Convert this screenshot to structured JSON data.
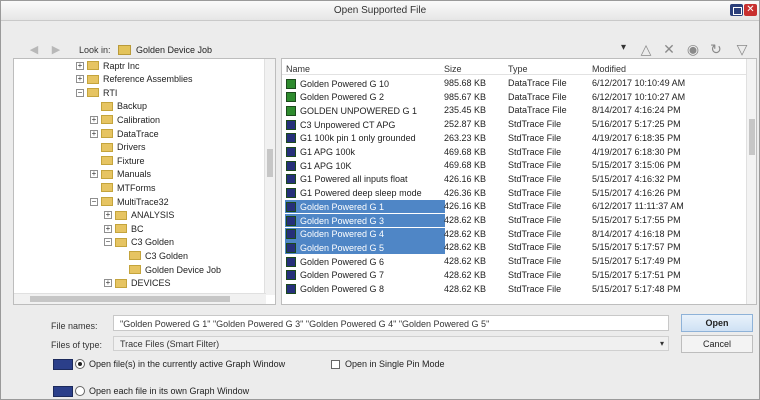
{
  "window": {
    "title": "Open Supported File"
  },
  "lookin": {
    "label": "Look in:",
    "value": "Golden Device Job"
  },
  "icons": {
    "back": "arrow-left-icon",
    "forward": "arrow-right-icon",
    "up": "triangle-up-icon",
    "delete": "x-icon",
    "view": "circle-view-icon",
    "refresh": "refresh-icon",
    "filter": "funnel-icon"
  },
  "tree": [
    {
      "label": "Raptr Inc",
      "level": 1,
      "exp": "+"
    },
    {
      "label": "Reference Assemblies",
      "level": 1,
      "exp": "+"
    },
    {
      "label": "RTI",
      "level": 1,
      "exp": "-"
    },
    {
      "label": "Backup",
      "level": 2,
      "exp": ""
    },
    {
      "label": "Calibration",
      "level": 2,
      "exp": "+"
    },
    {
      "label": "DataTrace",
      "level": 2,
      "exp": "+"
    },
    {
      "label": "Drivers",
      "level": 2,
      "exp": ""
    },
    {
      "label": "Fixture",
      "level": 2,
      "exp": ""
    },
    {
      "label": "Manuals",
      "level": 2,
      "exp": "+"
    },
    {
      "label": "MTForms",
      "level": 2,
      "exp": ""
    },
    {
      "label": "MultiTrace32",
      "level": 2,
      "exp": "-"
    },
    {
      "label": "ANALYSIS",
      "level": 3,
      "exp": "+"
    },
    {
      "label": "BC",
      "level": 3,
      "exp": "+"
    },
    {
      "label": "C3 Golden",
      "level": 3,
      "exp": "-"
    },
    {
      "label": "C3 Golden",
      "level": 4,
      "exp": ""
    },
    {
      "label": "Golden Device Job",
      "level": 4,
      "exp": ""
    },
    {
      "label": "DEVICES",
      "level": 3,
      "exp": "+"
    }
  ],
  "columns": {
    "name": "Name",
    "size": "Size",
    "type": "Type",
    "modified": "Modified"
  },
  "files": [
    {
      "name": "Golden Powered G 10",
      "size": "985.68 KB",
      "type": "DataTrace File",
      "modified": "6/12/2017 10:10:49 AM",
      "icon": "green",
      "selected": false
    },
    {
      "name": "Golden Powered G 2",
      "size": "985.67 KB",
      "type": "DataTrace File",
      "modified": "6/12/2017 10:10:27 AM",
      "icon": "green",
      "selected": false
    },
    {
      "name": "GOLDEN UNPOWERED G 1",
      "size": "235.45 KB",
      "type": "DataTrace File",
      "modified": "8/14/2017 4:16:24 PM",
      "icon": "green",
      "selected": false
    },
    {
      "name": "C3 Unpowered CT APG",
      "size": "252.87 KB",
      "type": "StdTrace File",
      "modified": "5/16/2017 5:17:25 PM",
      "icon": "navy",
      "selected": false
    },
    {
      "name": "G1 100k pin 1 only grounded",
      "size": "263.23 KB",
      "type": "StdTrace File",
      "modified": "4/19/2017 6:18:35 PM",
      "icon": "navy",
      "selected": false
    },
    {
      "name": "G1 APG 100k",
      "size": "469.68 KB",
      "type": "StdTrace File",
      "modified": "4/19/2017 6:18:30 PM",
      "icon": "navy",
      "selected": false
    },
    {
      "name": "G1 APG 10K",
      "size": "469.68 KB",
      "type": "StdTrace File",
      "modified": "5/15/2017 3:15:06 PM",
      "icon": "navy",
      "selected": false
    },
    {
      "name": "G1 Powered all inputs float",
      "size": "426.16 KB",
      "type": "StdTrace File",
      "modified": "5/15/2017 4:16:32 PM",
      "icon": "navy",
      "selected": false
    },
    {
      "name": "G1 Powered deep sleep mode",
      "size": "426.36 KB",
      "type": "StdTrace File",
      "modified": "5/15/2017 4:16:26 PM",
      "icon": "navy",
      "selected": false
    },
    {
      "name": "Golden Powered G 1",
      "size": "426.16 KB",
      "type": "StdTrace File",
      "modified": "6/12/2017 11:11:37 AM",
      "icon": "navy",
      "selected": true
    },
    {
      "name": "Golden Powered G 3",
      "size": "428.62 KB",
      "type": "StdTrace File",
      "modified": "5/15/2017 5:17:55 PM",
      "icon": "navy",
      "selected": true
    },
    {
      "name": "Golden Powered G 4",
      "size": "428.62 KB",
      "type": "StdTrace File",
      "modified": "8/14/2017 4:16:18 PM",
      "icon": "navy",
      "selected": true
    },
    {
      "name": "Golden Powered G 5",
      "size": "428.62 KB",
      "type": "StdTrace File",
      "modified": "5/15/2017 5:17:57 PM",
      "icon": "navy",
      "selected": true
    },
    {
      "name": "Golden Powered G 6",
      "size": "428.62 KB",
      "type": "StdTrace File",
      "modified": "5/15/2017 5:17:49 PM",
      "icon": "navy",
      "selected": false
    },
    {
      "name": "Golden Powered G 7",
      "size": "428.62 KB",
      "type": "StdTrace File",
      "modified": "5/15/2017 5:17:51 PM",
      "icon": "navy",
      "selected": false
    },
    {
      "name": "Golden Powered G 8",
      "size": "428.62 KB",
      "type": "StdTrace File",
      "modified": "5/15/2017 5:17:48 PM",
      "icon": "navy",
      "selected": false
    }
  ],
  "form": {
    "filename_label": "File names:",
    "filename_value": "\"Golden Powered G 1\" \"Golden Powered G 3\" \"Golden Powered G 4\" \"Golden Powered G 5\"",
    "filetype_label": "Files of type:",
    "filetype_value": "Trace Files (Smart Filter)",
    "open_label": "Open",
    "cancel_label": "Cancel"
  },
  "options": {
    "active_graph": "Open file(s) in the currently active Graph Window",
    "single_pin": "Open in Single Pin Mode",
    "own_graph": "Open each file in its own Graph Window"
  },
  "colors": {
    "selection": "#4f86c6",
    "green_icon": "#2e8b2e",
    "navy_icon": "#26307a"
  }
}
